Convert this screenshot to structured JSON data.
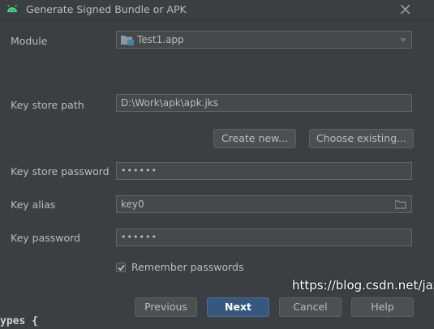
{
  "window": {
    "title": "Generate Signed Bundle or APK",
    "close_icon": "×"
  },
  "module": {
    "label": "Module",
    "value": "Test1.app"
  },
  "key_store_path": {
    "label": "Key store path",
    "value": "D:\\Work\\apk\\apk.jks"
  },
  "buttons": {
    "create_new": "Create new...",
    "choose_existing": "Choose existing...",
    "previous": "Previous",
    "next": "Next",
    "cancel": "Cancel",
    "help": "Help"
  },
  "key_store_password": {
    "label": "Key store password",
    "value": "••••••"
  },
  "key_alias": {
    "label": "Key alias",
    "value": "key0"
  },
  "key_password": {
    "label": "Key password",
    "value": "••••••"
  },
  "remember": {
    "label": "Remember passwords",
    "checked": true
  },
  "watermark": "https://blog.csdn.net/jaz",
  "background_code": "ypes {",
  "colors": {
    "background": "#3c3f41",
    "primary_button": "#365880",
    "android_green": "#3ddc84"
  }
}
